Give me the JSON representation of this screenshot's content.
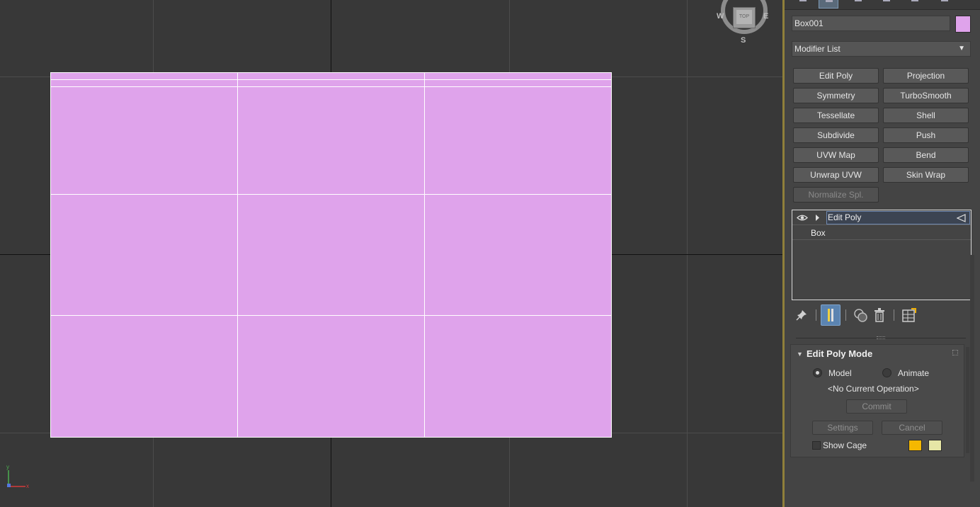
{
  "viewcube": {
    "top": "TOP",
    "west": "W",
    "east": "E",
    "south": "S"
  },
  "tripod": {
    "x": "x",
    "y": "y"
  },
  "object": {
    "name": "Box001",
    "color": "#dfa3eb"
  },
  "modifier_list": {
    "label": "Modifier List"
  },
  "modifier_buttons": [
    "Edit Poly",
    "Projection",
    "Symmetry",
    "TurboSmooth",
    "Tessellate",
    "Shell",
    "Subdivide",
    "Push",
    "UVW Map",
    "Bend",
    "Unwrap UVW",
    "Skin Wrap",
    "Normalize Spl."
  ],
  "stack": {
    "items": [
      "Edit Poly",
      "Box"
    ]
  },
  "edit_poly_mode": {
    "title": "Edit Poly Mode",
    "model_label": "Model",
    "animate_label": "Animate",
    "operation": "<No Current Operation>",
    "commit": "Commit",
    "settings": "Settings",
    "cancel": "Cancel",
    "show_cage": "Show Cage",
    "cage_color1": "#f5b800",
    "cage_color2": "#e6e6a6"
  }
}
